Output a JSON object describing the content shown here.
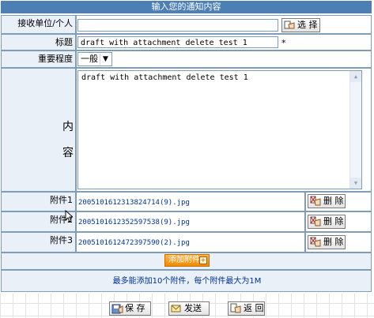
{
  "form": {
    "title": "输入您的通知内容",
    "receiver_label": "接收单位/个人",
    "receiver_value": "",
    "select_button": "选 择",
    "subject_label": "标题",
    "subject_value": "draft with attachment delete test 1",
    "required_mark": "*",
    "priority_label": "重要程度",
    "priority_value": "一般",
    "content_label_1": "内",
    "content_label_2": "容",
    "content_value": "draft with attachment delete test 1"
  },
  "attachments": [
    {
      "label": "附件1",
      "file": "20051016123138247​14(9).jpg",
      "delete": "删 除"
    },
    {
      "label": "附件2",
      "file": "20051016123525975​38(9).jpg",
      "delete": "删 除"
    },
    {
      "label": "附件3",
      "file": "20051016124723975​90(2).jpg",
      "delete": "删 除"
    }
  ],
  "add_attachment": "添加附件",
  "note": "最多能添加10个附件，每个附件最大为1M",
  "actions": {
    "save": "保 存",
    "send": "发送",
    "back": "返 回"
  }
}
